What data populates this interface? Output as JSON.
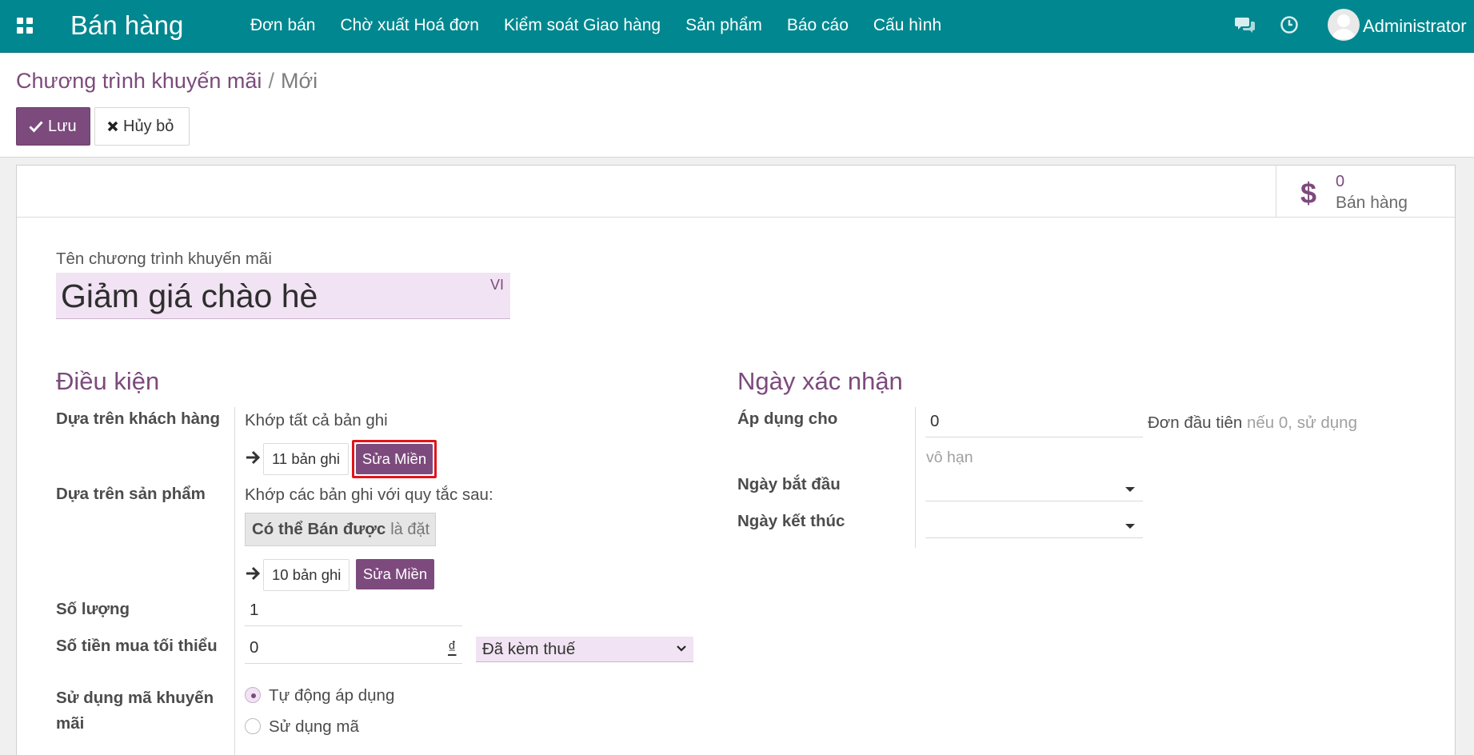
{
  "nav": {
    "brand": "Bán hàng",
    "menu": [
      "Đơn bán",
      "Chờ xuất Hoá đơn",
      "Kiểm soát Giao hàng",
      "Sản phẩm",
      "Báo cáo",
      "Cấu hình"
    ],
    "user": "Administrator",
    "icons": {
      "apps": "apps-grid-icon",
      "chat": "chat-icon",
      "activity": "clock-icon"
    }
  },
  "breadcrumb": {
    "parent": "Chương trình khuyến mãi",
    "separator": "/",
    "current": "Mới"
  },
  "toolbar": {
    "save_label": "Lưu",
    "cancel_label": "Hủy bỏ"
  },
  "stat": {
    "value": "0",
    "label": "Bán hàng"
  },
  "form": {
    "name_label": "Tên chương trình khuyến mãi",
    "name_value": "Giảm giá chào hè",
    "lang": "VI",
    "conditions": {
      "title": "Điều kiện",
      "customer_label": "Dựa trên khách hàng",
      "customer_match": "Khớp tất cả bản ghi",
      "customer_count": "11 bản ghi",
      "edit_domain": "Sửa Miền",
      "product_label": "Dựa trên sản phẩm",
      "product_match": "Khớp các bản ghi với quy tắc sau:",
      "rule_field": "Có thể Bán được",
      "rule_op": "là đặt",
      "product_count": "10 bản ghi",
      "qty_label": "Số lượng",
      "qty_value": "1",
      "min_amount_label": "Số tiền mua tối thiểu",
      "min_amount_value": "0",
      "currency": "₫",
      "tax_option": "Đã kèm thuế",
      "code_label": "Sử dụng mã khuyến mãi",
      "radio_auto": "Tự động áp dụng",
      "radio_code": "Sử dụng mã"
    },
    "validity": {
      "title": "Ngày xác nhận",
      "apply_label": "Áp dụng cho",
      "apply_value": "0",
      "apply_suffix": "Đơn đầu tiên",
      "apply_hint": "nếu 0, sử dụng",
      "apply_hint2": "vô hạn",
      "start_label": "Ngày bắt đầu",
      "end_label": "Ngày kết thúc"
    }
  }
}
